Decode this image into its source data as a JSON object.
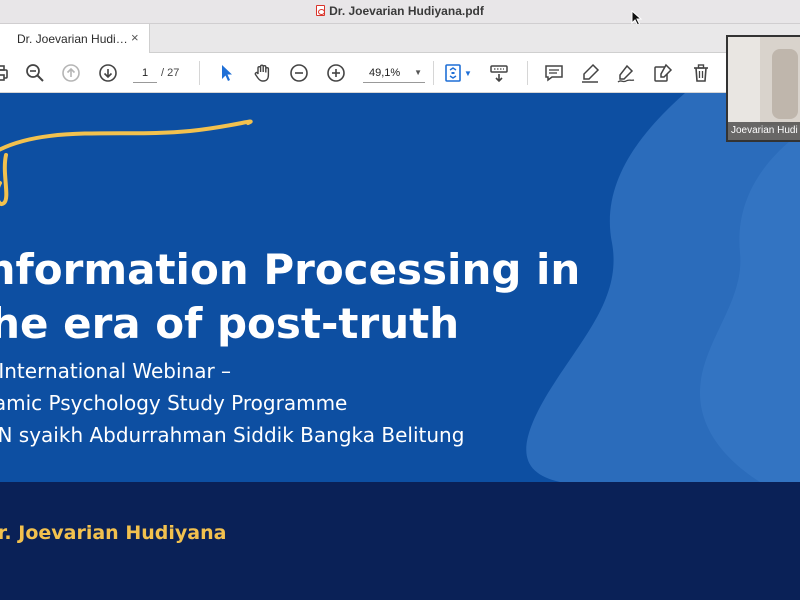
{
  "window": {
    "title": "Dr. Joevarian Hudiyana.pdf",
    "file_icon": "pdf-file-icon"
  },
  "tabs": [
    {
      "label": "Dr. Joevarian Hudi…",
      "close_label": "×",
      "active": true
    }
  ],
  "toolbar": {
    "page_current": "1",
    "page_total": "/ 27",
    "zoom_value": "49,1%",
    "zoom_caret": "▼",
    "icons": [
      "print-icon",
      "zoom-out-magnifier-icon",
      "previous-page-icon",
      "next-page-icon",
      "select-cursor-icon",
      "hand-tool-icon",
      "zoom-minus-icon",
      "zoom-plus-icon",
      "fit-page-icon",
      "keyboard-scroll-icon",
      "comment-icon",
      "highlight-icon",
      "sign-icon",
      "edit-icon",
      "delete-icon"
    ],
    "accent_color": "#1f6fd6"
  },
  "slide": {
    "title_line1": "Information Processing in",
    "title_line2": "the era of post-truth",
    "subtitle_line1": "— International Webinar –",
    "subtitle_line2": "Islamic Psychology Study Programme",
    "subtitle_line3": "IAIN syaikh Abdurrahman Siddik Bangka Belitung",
    "presenter": "Dr. Joevarian Hudiyana",
    "colors": {
      "background": "#0d4fa2",
      "wave_light": "#2b6cbb",
      "footer": "#0a2157",
      "accent_gold": "#f2c14e"
    }
  },
  "webcam": {
    "participant_name": "Joevarian Hudi"
  }
}
